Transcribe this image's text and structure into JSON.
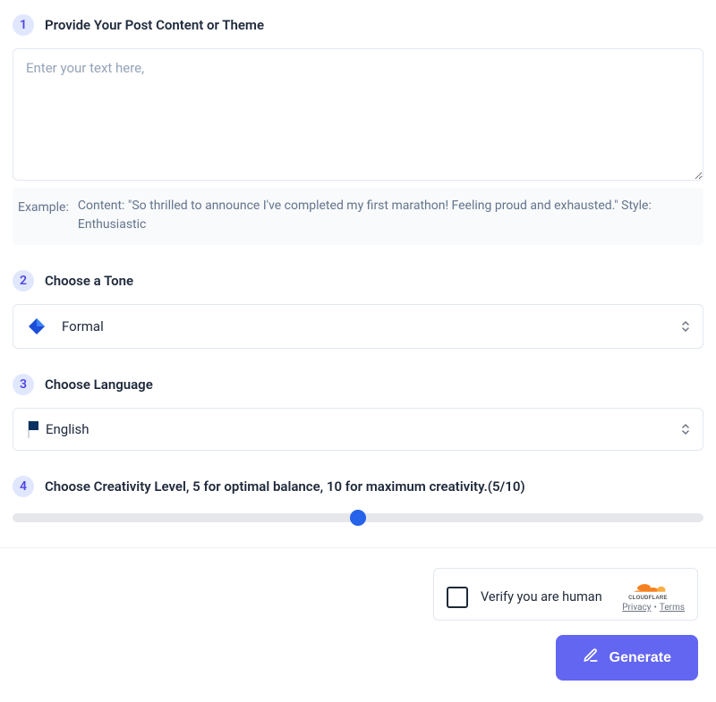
{
  "steps": {
    "s1": {
      "number": "1",
      "title": "Provide Your Post Content or Theme",
      "placeholder": "Enter your text here,",
      "example_label": "Example:",
      "example_text": "Content: \"So thrilled to announce I've completed my first marathon! Feeling proud and exhausted.\" Style: Enthusiastic"
    },
    "s2": {
      "number": "2",
      "title": "Choose a Tone",
      "selected": "Formal",
      "icon": "blue-diamond-icon"
    },
    "s3": {
      "number": "3",
      "title": "Choose Language",
      "selected": "English",
      "icon": "us-flag-icon"
    },
    "s4": {
      "number": "4",
      "title": "Choose Creativity Level, 5 for optimal balance, 10 for maximum creativity.(5/10)",
      "value": 5,
      "min": 0,
      "max": 10
    }
  },
  "captcha": {
    "label": "Verify you are human",
    "brand": "CLOUDFLARE",
    "privacy": "Privacy",
    "terms": "Terms"
  },
  "buttons": {
    "generate": "Generate"
  },
  "colors": {
    "accent": "#6366f1",
    "slider_handle": "#2563eb",
    "step_badge_bg": "#e0e7ff",
    "step_badge_fg": "#4f46e5"
  }
}
